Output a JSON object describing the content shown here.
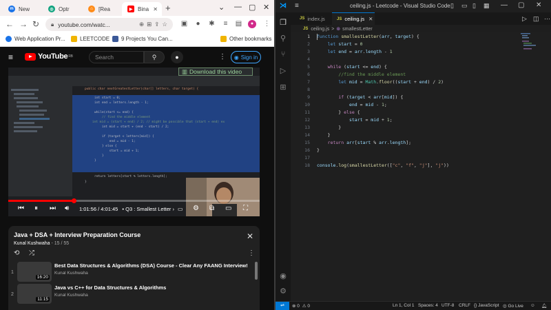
{
  "browser": {
    "tabs": [
      {
        "label": "New",
        "color": "#1a73e8",
        "glyph": "m"
      },
      {
        "label": "Optr",
        "color": "#10a37f",
        "glyph": "◎"
      },
      {
        "label": "[Rea",
        "color": "#ff8c1a",
        "glyph": "⌂"
      },
      {
        "label": "Bina",
        "color": "#ff0000",
        "glyph": "▶"
      }
    ],
    "address": "youtube.com/watc...",
    "bookmarks": [
      {
        "label": "Web Application Pr...",
        "color": "#1a73e8"
      },
      {
        "label": "LEETCODE",
        "color": "#f0b400"
      },
      {
        "label": "9 Projects You Can...",
        "color": "#3b5998"
      },
      {
        "label": "Other bookmarks",
        "color": "#f0b400"
      }
    ]
  },
  "youtube": {
    "logo": "YouTube",
    "logo_sup": "RB",
    "search_placeholder": "Search",
    "signin": "Sign in",
    "download": "Download this video",
    "ide_header": "public char nextGreatestLetter(char[] letters, char target) {",
    "ide_lines": [
      "int start = 0;",
      "int end = letters.length - 1;",
      "",
      "while(start <= end) {",
      "    // find the middle element",
      "    int mid = (start + end) / 2; // might be possible that (start + end) ex",
      "    int mid = start + (end - start) / 2;",
      "",
      "    if (target < letters[mid]) {",
      "        end = mid - 1;",
      "    } else {",
      "        start = mid + 1;",
      "    }",
      "}",
      "return letters[start % letters.length];",
      "}"
    ],
    "time": "1:01:56 / 4:01:45",
    "chapter": "• Q3 : Smallest Letter  ›",
    "progress": 0.26,
    "playlist_title": "Java + DSA + Interview Preparation Course",
    "playlist_author": "Kunal Kushwaha",
    "playlist_position": "- 15 / 55",
    "playlist_items": [
      {
        "num": "1",
        "title": "Best Data Structures & Algorithms (DSA) Course - Clear Any FAANG Interview!",
        "author": "Kunal Kushwaha",
        "duration": "16:20"
      },
      {
        "num": "2",
        "title": "Java vs C++ for Data Structures & Algorithms",
        "author": "Kunal Kushwaha",
        "duration": "11:15"
      }
    ]
  },
  "vscode": {
    "title": "ceiling.js - Leetcode - Visual Studio Code",
    "tabs": [
      {
        "label": "index.js",
        "badge": "JS",
        "active": false
      },
      {
        "label": "ceiling.js",
        "badge": "JS",
        "active": true
      }
    ],
    "breadcrumb_file": "ceiling.js",
    "breadcrumb_sep": ">",
    "breadcrumb_symbol": "smallestLetter",
    "line_numbers": [
      "1",
      "2",
      "3",
      "4",
      "5",
      "6",
      "7",
      "8",
      "9",
      "10",
      "11",
      "12",
      "13",
      "14",
      "15",
      "16",
      "17",
      "18"
    ],
    "status": {
      "errors": "0",
      "warnings": "0",
      "position": "Ln 1, Col 1",
      "spaces": "Spaces: 4",
      "encoding": "UTF-8",
      "eol": "CRLF",
      "language": "JavaScript",
      "golive": "Go Live"
    }
  }
}
